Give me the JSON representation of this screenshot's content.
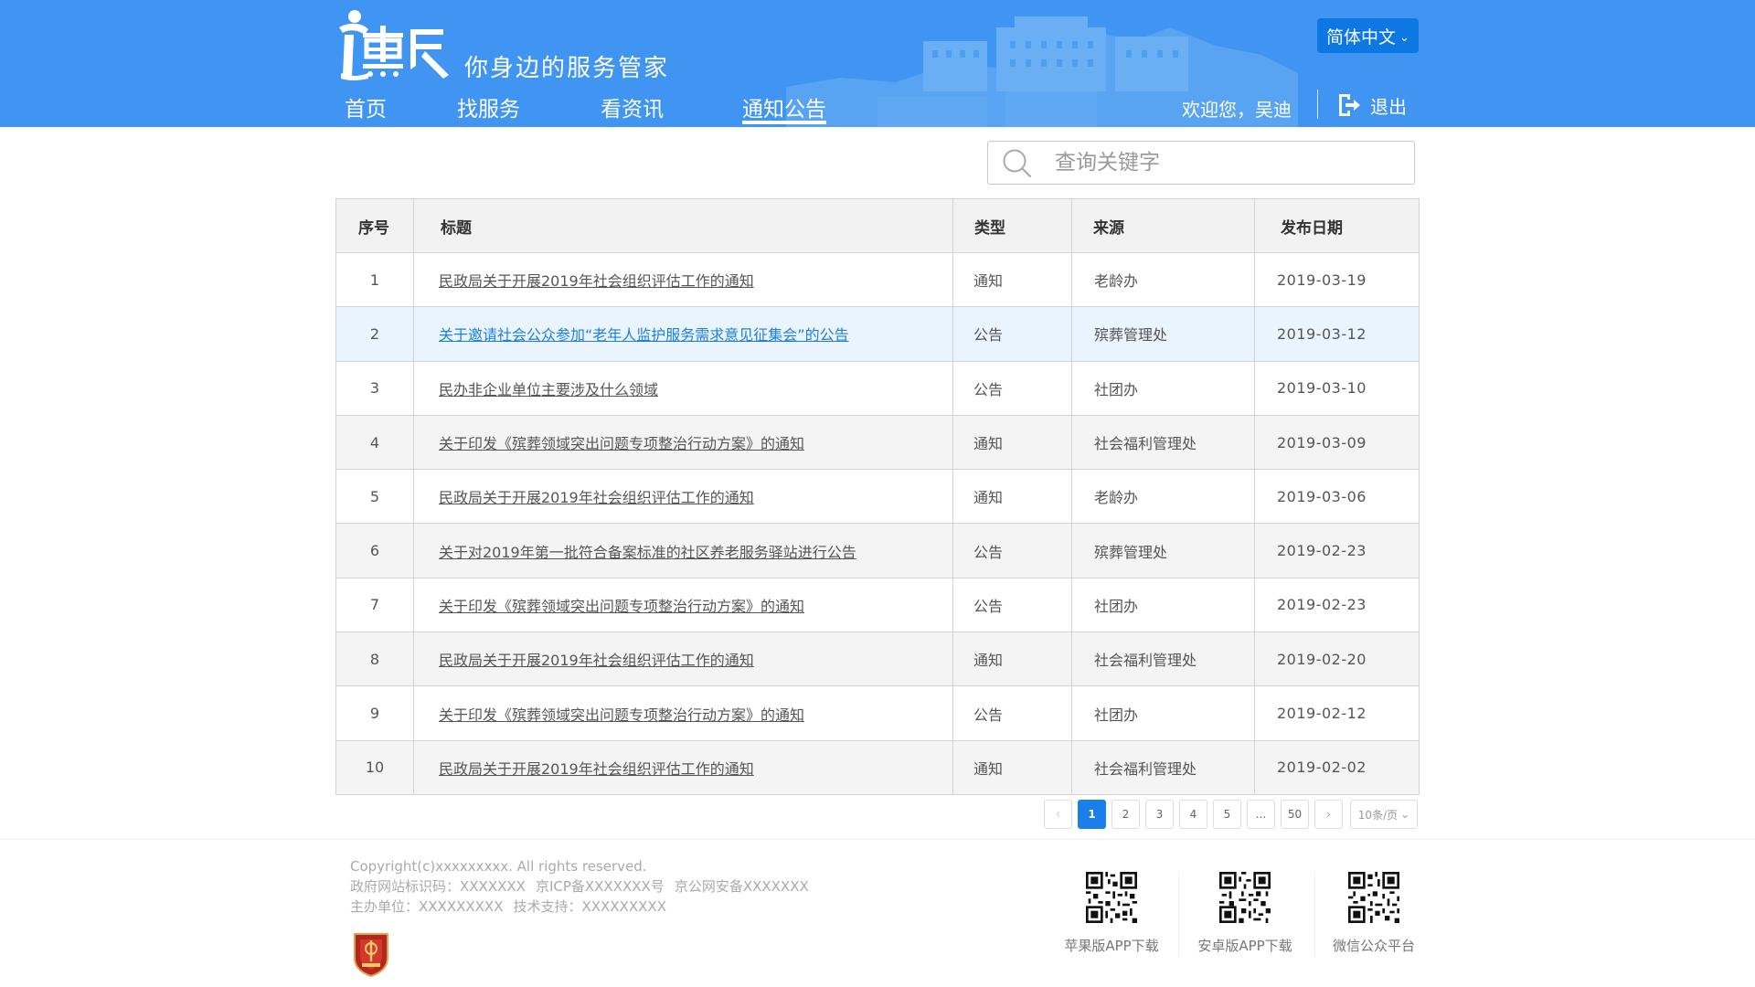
{
  "brand": {
    "logo_text": "惠民",
    "slogan": "你身边的服务管家"
  },
  "language": {
    "label": "简体中文"
  },
  "nav": {
    "items": [
      {
        "label": "首页"
      },
      {
        "label": "找服务"
      },
      {
        "label": "看资讯"
      },
      {
        "label": "通知公告",
        "active": true
      }
    ]
  },
  "user": {
    "welcome": "欢迎您，吴迪",
    "logout_label": "退出"
  },
  "search": {
    "placeholder": "查询关键字",
    "value": ""
  },
  "table": {
    "headers": {
      "index": "序号",
      "title": "标题",
      "type": "类型",
      "source": "来源",
      "date": "发布日期"
    },
    "rows": [
      {
        "index": "1",
        "title": "民政局关于开展2019年社会组织评估工作的通知",
        "type": "通知",
        "source": "老龄办",
        "date": "2019-03-19"
      },
      {
        "index": "2",
        "title": "关于邀请社会公众参加“老年人监护服务需求意见征集会”的公告",
        "type": "公告",
        "source": "殡葬管理处",
        "date": "2019-03-12",
        "highlight": true
      },
      {
        "index": "3",
        "title": "民办非企业单位主要涉及什么领域",
        "type": "公告",
        "source": "社团办",
        "date": "2019-03-10"
      },
      {
        "index": "4",
        "title": "关于印发《殡葬领域突出问题专项整治行动方案》的通知",
        "type": "通知",
        "source": "社会福利管理处",
        "date": "2019-03-09"
      },
      {
        "index": "5",
        "title": "民政局关于开展2019年社会组织评估工作的通知",
        "type": "通知",
        "source": "老龄办",
        "date": "2019-03-06"
      },
      {
        "index": "6",
        "title": "关于对2019年第一批符合备案标准的社区养老服务驿站进行公告",
        "type": "公告",
        "source": "殡葬管理处",
        "date": "2019-02-23"
      },
      {
        "index": "7",
        "title": "关于印发《殡葬领域突出问题专项整治行动方案》的通知",
        "type": "公告",
        "source": "社团办",
        "date": "2019-02-23"
      },
      {
        "index": "8",
        "title": "民政局关于开展2019年社会组织评估工作的通知",
        "type": "通知",
        "source": "社会福利管理处",
        "date": "2019-02-20"
      },
      {
        "index": "9",
        "title": "关于印发《殡葬领域突出问题专项整治行动方案》的通知",
        "type": "公告",
        "source": "社团办",
        "date": "2019-02-12"
      },
      {
        "index": "10",
        "title": "民政局关于开展2019年社会组织评估工作的通知",
        "type": "通知",
        "source": "社会福利管理处",
        "date": "2019-02-02"
      }
    ]
  },
  "pagination": {
    "prev": "‹",
    "pages": [
      "1",
      "2",
      "3",
      "4",
      "5",
      "...",
      "50"
    ],
    "current": "1",
    "next": "›",
    "page_size": "10条/页"
  },
  "footer": {
    "copyright": "Copyright(c)xxxxxxxxx. All rights reserved.",
    "line2": [
      "政府网站标识码：XXXXXXX",
      "京ICP备XXXXXXX号",
      "京公网安备XXXXXXX"
    ],
    "line3": [
      "主办单位：XXXXXXXXX",
      "技术支持：XXXXXXXXX"
    ],
    "qr_codes": [
      {
        "label": "苹果版APP下载"
      },
      {
        "label": "安卓版APP下载"
      },
      {
        "label": "微信公众平台"
      }
    ]
  },
  "colors": {
    "header_bg": "#3f95f1",
    "accent": "#1a7fe8",
    "lang_btn": "#0d77e3",
    "highlight_row": "#eaf4ff",
    "link_highlight": "#1d7fe0"
  }
}
